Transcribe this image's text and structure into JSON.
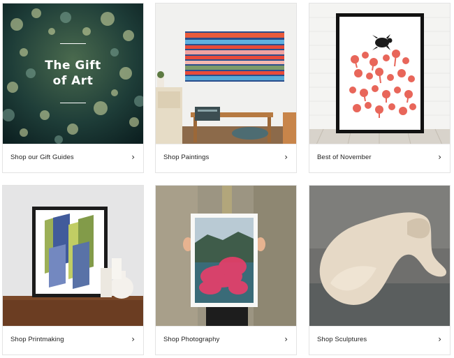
{
  "cards": [
    {
      "label": "Shop our Gift Guides",
      "overlay_title_line1": "The Gift",
      "overlay_title_line2": "of Art",
      "chevron": "›"
    },
    {
      "label": "Shop Paintings",
      "chevron": "›"
    },
    {
      "label": "Best of November",
      "chevron": "›"
    },
    {
      "label": "Shop Printmaking",
      "chevron": "›"
    },
    {
      "label": "Shop Photography",
      "chevron": "›"
    },
    {
      "label": "Shop Sculptures",
      "chevron": "›"
    }
  ],
  "colors": {
    "coral": "#e8665a",
    "bokeh_dark": "#12302e",
    "stripe_red": "#e84a3a",
    "stripe_blue": "#3b8fd0"
  }
}
